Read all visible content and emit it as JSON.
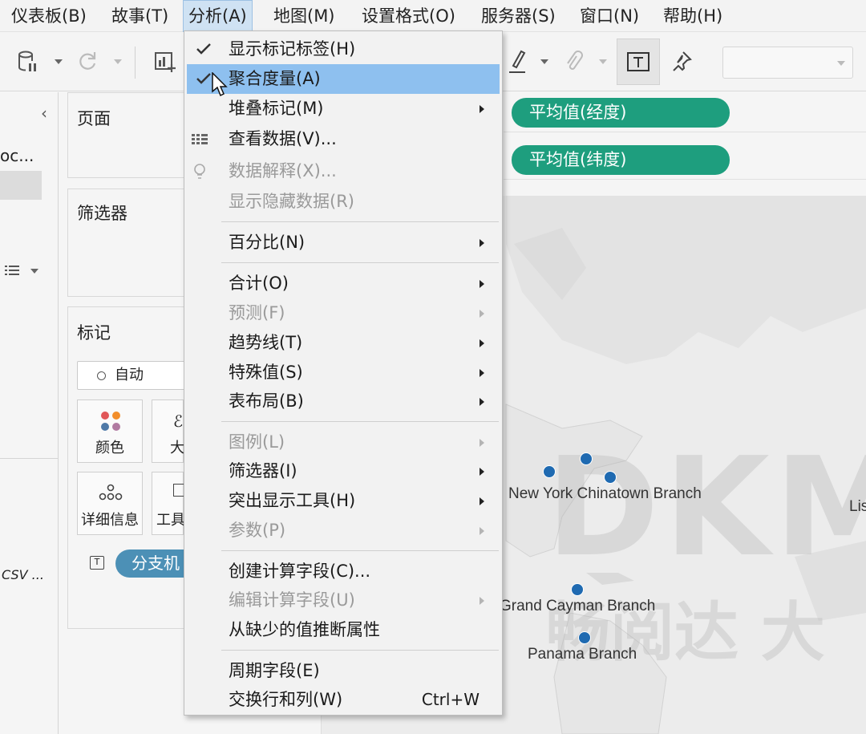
{
  "menubar": {
    "items": [
      {
        "label": "仪表板(B)"
      },
      {
        "label": "故事(T)"
      },
      {
        "label": "分析(A)"
      },
      {
        "label": "地图(M)"
      },
      {
        "label": "设置格式(O)"
      },
      {
        "label": "服务器(S)"
      },
      {
        "label": "窗口(N)"
      },
      {
        "label": "帮助(H)"
      }
    ]
  },
  "leftpanel": {
    "truncated_label": "oc...",
    "file_label": "CSV ..."
  },
  "cards": {
    "pages_title": "页面",
    "filters_title": "筛选器",
    "marks_title": "标记",
    "marks_type": "自动",
    "color_label": "颜色",
    "size_label": "大",
    "detail_label": "详细信息",
    "tooltip_label": "工具",
    "text_icon": "T",
    "branch_pill": "分支机"
  },
  "shelves": {
    "columns_pill": "平均值(经度)",
    "rows_pill": "平均值(纬度)"
  },
  "map": {
    "labels": [
      {
        "text": "New York Chinatown Branch"
      },
      {
        "text": "Grand Cayman Branch"
      },
      {
        "text": "Panama Branch"
      },
      {
        "text": "Lis"
      }
    ],
    "watermark": "DKM",
    "watermark_cn": "畅阅达 大"
  },
  "dropdown": {
    "items": [
      {
        "label": "显示标记标签(H)",
        "checked": true
      },
      {
        "label": "聚合度量(A)",
        "checked": true,
        "highlighted": true
      },
      {
        "label": "堆叠标记(M)",
        "submenu": true
      },
      {
        "label": "查看数据(V)...",
        "icon": "table-icon"
      },
      {
        "label": "数据解释(X)...",
        "disabled": true,
        "icon": "lightbulb-icon"
      },
      {
        "label": "显示隐藏数据(R)",
        "disabled": true
      },
      {
        "label": "百分比(N)",
        "submenu": true
      },
      {
        "label": "合计(O)",
        "submenu": true
      },
      {
        "label": "预测(F)",
        "submenu": true,
        "disabled": true
      },
      {
        "label": "趋势线(T)",
        "submenu": true
      },
      {
        "label": "特殊值(S)",
        "submenu": true
      },
      {
        "label": "表布局(B)",
        "submenu": true
      },
      {
        "label": "图例(L)",
        "submenu": true,
        "disabled": true
      },
      {
        "label": "筛选器(I)",
        "submenu": true
      },
      {
        "label": "突出显示工具(H)",
        "submenu": true
      },
      {
        "label": "参数(P)",
        "submenu": true,
        "disabled": true
      },
      {
        "label": "创建计算字段(C)..."
      },
      {
        "label": "编辑计算字段(U)",
        "submenu": true,
        "disabled": true
      },
      {
        "label": "从缺少的值推断属性"
      },
      {
        "label": "周期字段(E)"
      },
      {
        "label": "交换行和列(W)",
        "shortcut": "Ctrl+W"
      }
    ]
  },
  "colors": {
    "highlight": "#8ec0ef",
    "pill_green": "#1e9e7e",
    "pill_blue": "#4c90b6",
    "map_dot": "#1f6ab1"
  }
}
